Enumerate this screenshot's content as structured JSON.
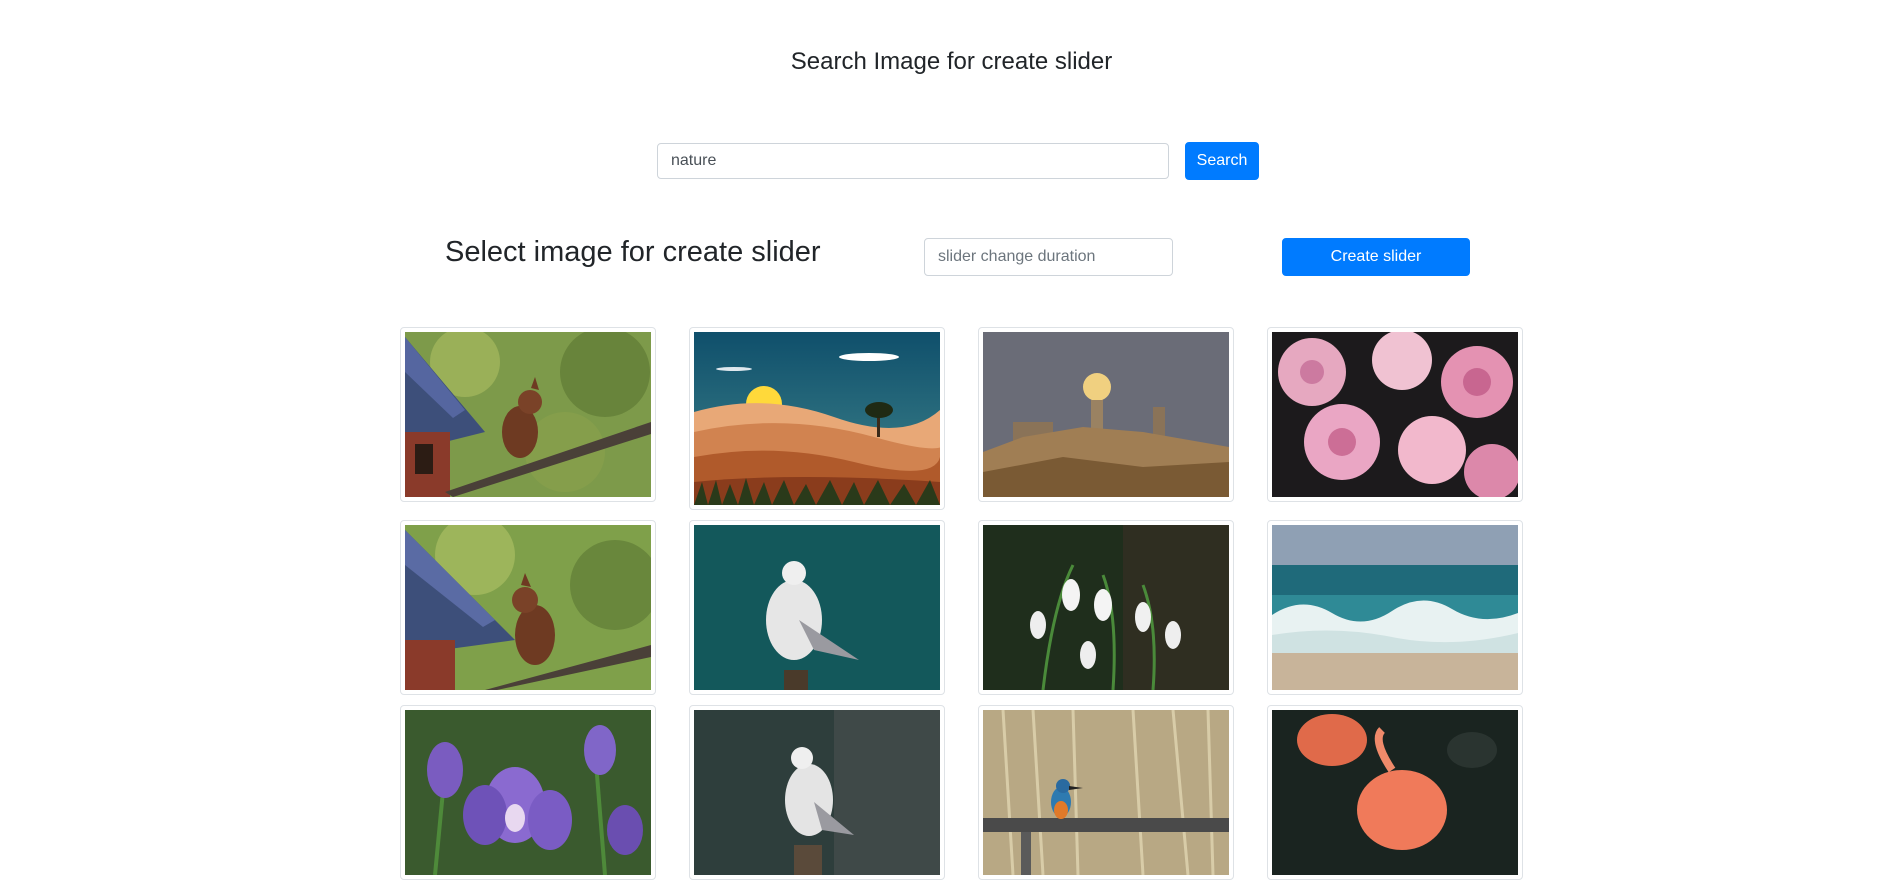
{
  "header": {
    "title": "Search Image for create slider"
  },
  "search": {
    "value": "nature",
    "button_label": "Search"
  },
  "slider": {
    "heading": "Select image for create slider",
    "duration_placeholder": "slider change duration",
    "create_label": "Create slider"
  },
  "gallery": {
    "images": [
      {
        "subject": "squirrel-on-birdhouse"
      },
      {
        "subject": "desert-sunset-illustration"
      },
      {
        "subject": "full-moon-over-castle"
      },
      {
        "subject": "pink-roses"
      },
      {
        "subject": "squirrel-eating"
      },
      {
        "subject": "seagull-teal-background"
      },
      {
        "subject": "snowdrop-flowers"
      },
      {
        "subject": "ocean-waves-beach"
      },
      {
        "subject": "purple-iris"
      },
      {
        "subject": "seagull-on-post"
      },
      {
        "subject": "kingfisher-on-rail"
      },
      {
        "subject": "flamingo"
      }
    ]
  }
}
